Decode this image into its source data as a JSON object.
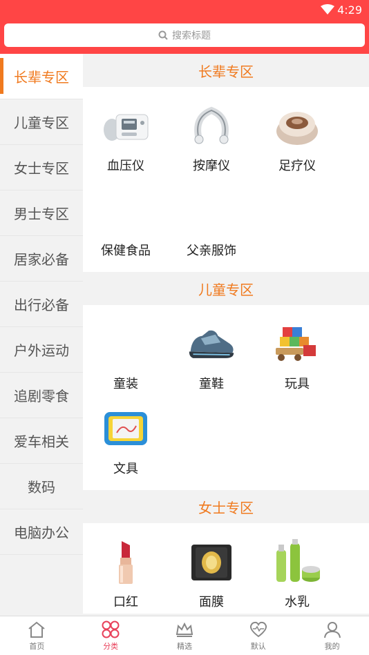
{
  "status": {
    "time": "4:29"
  },
  "search": {
    "placeholder": "搜索标题"
  },
  "sidebar": {
    "items": [
      {
        "label": "长辈专区"
      },
      {
        "label": "儿童专区"
      },
      {
        "label": "女士专区"
      },
      {
        "label": "男士专区"
      },
      {
        "label": "居家必备"
      },
      {
        "label": "出行必备"
      },
      {
        "label": "户外运动"
      },
      {
        "label": "追剧零食"
      },
      {
        "label": "爱车相关"
      },
      {
        "label": "数码"
      },
      {
        "label": "电脑办公"
      }
    ]
  },
  "sections": [
    {
      "title": "长辈专区",
      "items": [
        {
          "label": "血压仪",
          "icon": "blood-pressure-monitor-icon"
        },
        {
          "label": "按摩仪",
          "icon": "neck-massager-icon"
        },
        {
          "label": "足疗仪",
          "icon": "foot-spa-icon"
        },
        {
          "label": "保健食品",
          "icon": ""
        },
        {
          "label": "父亲服饰",
          "icon": ""
        }
      ]
    },
    {
      "title": "儿童专区",
      "items": [
        {
          "label": "童装",
          "icon": ""
        },
        {
          "label": "童鞋",
          "icon": "kids-shoe-icon"
        },
        {
          "label": "玩具",
          "icon": "toy-blocks-icon"
        },
        {
          "label": "文具",
          "icon": "drawing-board-icon"
        }
      ]
    },
    {
      "title": "女士专区",
      "items": [
        {
          "label": "口红",
          "icon": "lipstick-icon"
        },
        {
          "label": "面膜",
          "icon": "face-mask-icon"
        },
        {
          "label": "水乳",
          "icon": "skincare-bottles-icon"
        }
      ]
    }
  ],
  "tabs": [
    {
      "label": "首页",
      "icon": "home-icon"
    },
    {
      "label": "分类",
      "icon": "category-icon"
    },
    {
      "label": "精选",
      "icon": "crown-icon"
    },
    {
      "label": "默认",
      "icon": "heart-pulse-icon"
    },
    {
      "label": "我的",
      "icon": "user-icon"
    }
  ],
  "colors": {
    "accent": "#f07a1f",
    "header": "#ff4545",
    "tab_active": "#e8405a"
  }
}
